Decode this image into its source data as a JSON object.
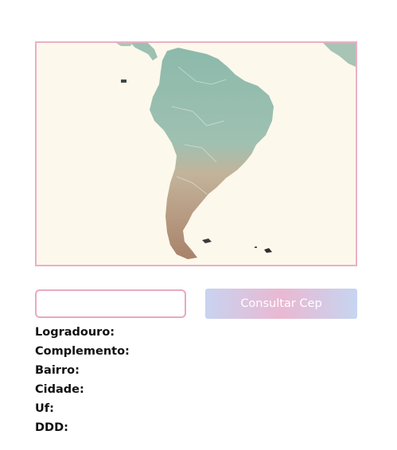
{
  "map": {
    "alt": "",
    "colors": {
      "ocean": "#fdf8ec",
      "north": "#8fb8ab",
      "south": "#b08d73",
      "border": "#eab0c4"
    }
  },
  "cep": {
    "value": "",
    "placeholder": ""
  },
  "consult_button": {
    "label": "Consultar Cep"
  },
  "results": {
    "logradouro": "Logradouro:",
    "complemento": "Complemento:",
    "bairro": "Bairro:",
    "cidade": "Cidade:",
    "uf": "Uf:",
    "ddd": "DDD:"
  }
}
